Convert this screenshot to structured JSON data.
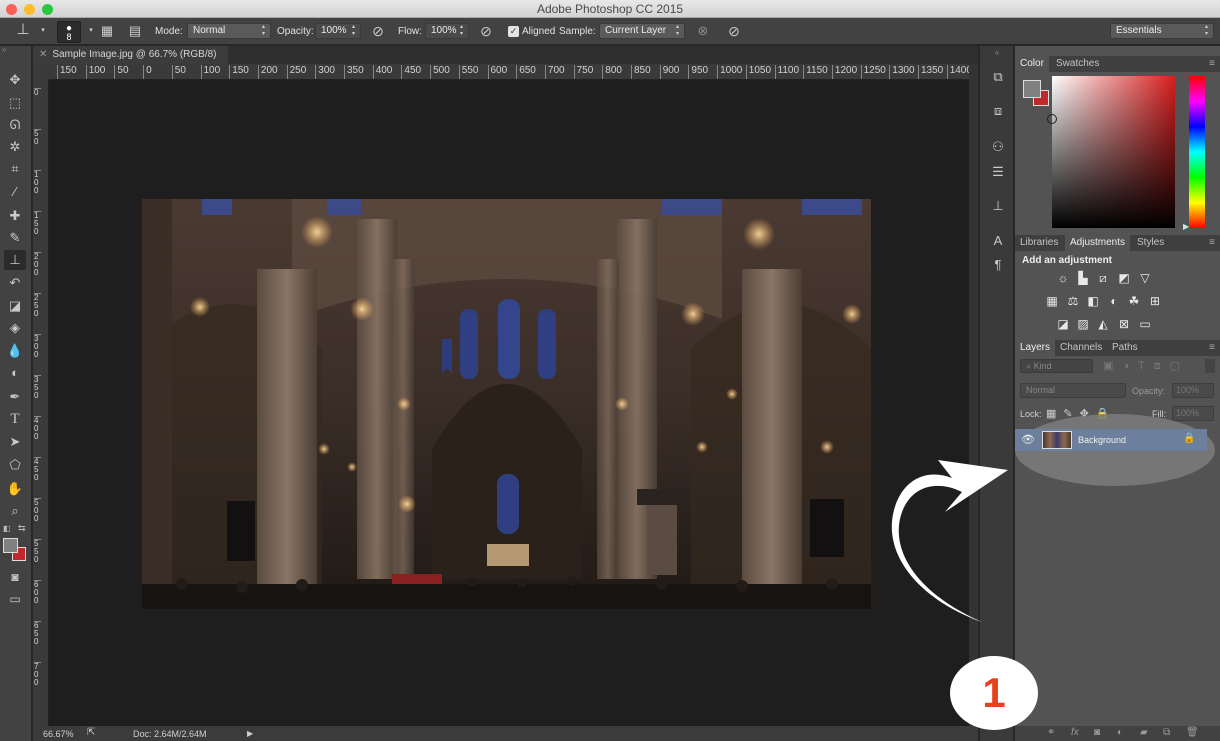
{
  "window": {
    "title": "Adobe Photoshop CC 2015",
    "traffic_colors": [
      "#fc5f57",
      "#fdbc2e",
      "#28c83f"
    ]
  },
  "options_bar": {
    "brush_size": "8",
    "mode_label": "Mode:",
    "mode_value": "Normal",
    "opacity_label": "Opacity:",
    "opacity_value": "100%",
    "flow_label": "Flow:",
    "flow_value": "100%",
    "aligned_label": "Aligned",
    "aligned_checked": true,
    "sample_label": "Sample:",
    "sample_value": "Current Layer",
    "workspace_value": "Essentials"
  },
  "document": {
    "tab_title": "Sample Image.jpg @ 66.7% (RGB/8)",
    "zoom": "66.67%",
    "doc_size": "Doc: 2.64M/2.64M",
    "h_ruler_ticks": [
      "150",
      "100",
      "50",
      "0",
      "50",
      "100",
      "150",
      "200",
      "250",
      "300",
      "350",
      "400",
      "450",
      "500",
      "550",
      "600",
      "650",
      "700",
      "750",
      "800",
      "850",
      "900",
      "950",
      "1000",
      "1050",
      "1100",
      "1150",
      "1200",
      "1250",
      "1300",
      "1350",
      "1400"
    ],
    "v_ruler_ticks": [
      "0",
      "50",
      "100",
      "150",
      "200",
      "250",
      "300",
      "350",
      "400",
      "450",
      "500",
      "550",
      "600",
      "650",
      "700"
    ]
  },
  "panels": {
    "color_tabs": [
      "Color",
      "Swatches"
    ],
    "adjust_tabs": [
      "Libraries",
      "Adjustments",
      "Styles"
    ],
    "adjust_title": "Add an adjustment",
    "layers_tabs": [
      "Layers",
      "Channels",
      "Paths"
    ],
    "filter_kind": "Kind",
    "blend_mode": "Normal",
    "opacity_label": "Opacity:",
    "opacity_value": "100%",
    "lock_label": "Lock:",
    "fill_label": "Fill:",
    "fill_value": "100%",
    "layer_name": "Background",
    "fg_color": "#808080",
    "bg_color": "#c0282b"
  },
  "annotation": {
    "step_number": "1",
    "step_color": "#e8411e"
  },
  "icons": {
    "tools": [
      "move-icon",
      "marquee-icon",
      "lasso-icon",
      "magic-wand-icon",
      "crop-icon",
      "eyedropper-icon",
      "spot-healing-icon",
      "brush-icon",
      "clone-stamp-icon",
      "history-brush-icon",
      "eraser-icon",
      "paint-bucket-icon",
      "blur-icon",
      "dodge-icon",
      "pen-icon",
      "type-icon",
      "path-selection-icon",
      "shape-icon",
      "hand-icon",
      "zoom-icon"
    ],
    "dock": [
      "history-icon",
      "properties-icon",
      "actions-icon",
      "tool-presets-icon",
      "clone-source-icon",
      "character-icon",
      "paragraph-icon"
    ]
  }
}
